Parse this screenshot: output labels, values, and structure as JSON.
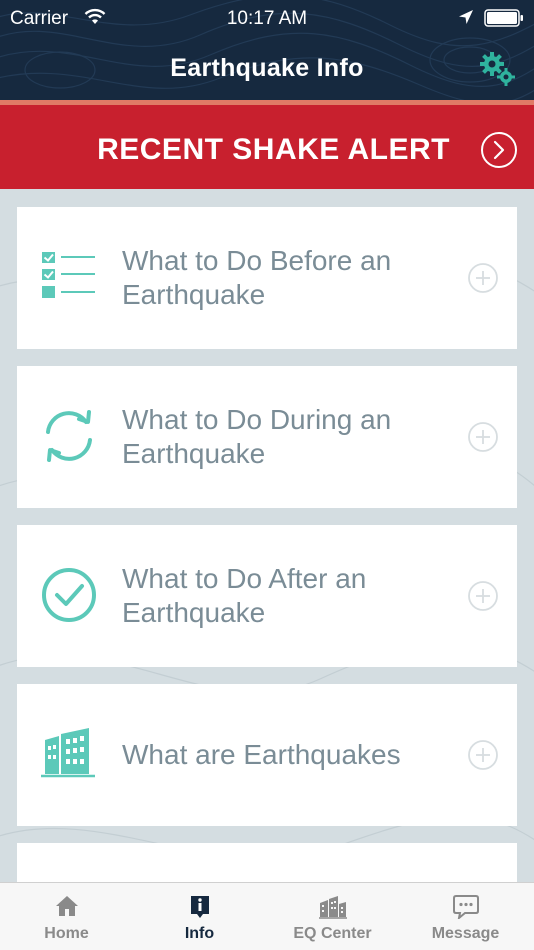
{
  "status_bar": {
    "carrier": "Carrier",
    "time": "10:17 AM",
    "icons": [
      "wifi-icon",
      "location-arrow-icon",
      "battery-icon"
    ]
  },
  "header": {
    "title": "Earthquake Info",
    "settings_icon": "gears-icon"
  },
  "alert_banner": {
    "label": "RECENT SHAKE ALERT",
    "icon": "chevron-right-circle-icon"
  },
  "cards": [
    {
      "label": "What to Do Before an Earthquake",
      "icon": "checklist-icon"
    },
    {
      "label": "What to Do During an Earthquake",
      "icon": "refresh-cycle-icon"
    },
    {
      "label": "What to Do After an Earthquake",
      "icon": "check-circle-icon"
    },
    {
      "label": "What are Earthquakes",
      "icon": "buildings-icon"
    }
  ],
  "tabbar": {
    "tabs": [
      {
        "label": "Home",
        "icon": "house-icon",
        "active": false
      },
      {
        "label": "Info",
        "icon": "info-icon",
        "active": true
      },
      {
        "label": "EQ Center",
        "icon": "city-buildings-icon",
        "active": false
      },
      {
        "label": "Message",
        "icon": "chat-bubble-icon",
        "active": false
      }
    ]
  },
  "colors": {
    "header_bg": "#16293f",
    "alert_red": "#c8202e",
    "accent_teal": "#5cc9b9",
    "card_text": "#7a8c96",
    "page_bg": "#d4dde1"
  }
}
